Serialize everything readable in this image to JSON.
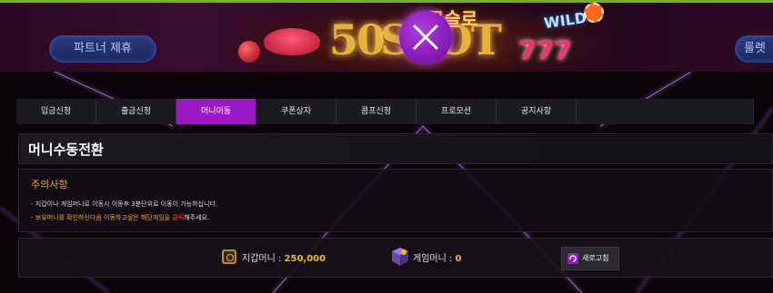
{
  "header": {
    "partner_button": "파트너 제휴",
    "right_button": "룰렛",
    "banner": {
      "big_text": "50",
      "slot_text": "SLOT",
      "top_text": "금슬로",
      "wild_text": "WILD",
      "sevens_text": "777"
    },
    "close_icon": "close-icon"
  },
  "tabs": [
    {
      "label": "입금신청",
      "active": false
    },
    {
      "label": "출금신청",
      "active": false
    },
    {
      "label": "머니이동",
      "active": true
    },
    {
      "label": "쿠폰상자",
      "active": false
    },
    {
      "label": "콤프신청",
      "active": false
    },
    {
      "label": "프로모션",
      "active": false
    },
    {
      "label": "공지사항",
      "active": false
    }
  ],
  "page_title": "머니수동전환",
  "notice": {
    "title": "주의사항",
    "line1": "- 지갑이나 게임머니로 이동시 이동후 3분단위로 이동이 가능하십니다.",
    "line2_pre": "- 보유머니를 확인하신다음 이동하고싶은 해당게임을 ",
    "line2_red": "클릭",
    "line2_post": "해주세요."
  },
  "money": {
    "wallet_label": "지갑머니 : ",
    "wallet_value": "250,000",
    "game_label": "게임머니 : ",
    "game_value": "0",
    "refresh_label": "새로고침"
  },
  "colors": {
    "accent": "#9a19c4",
    "highlight": "#f2c100",
    "warning": "#f0a830",
    "red": "#ff3a3a"
  }
}
